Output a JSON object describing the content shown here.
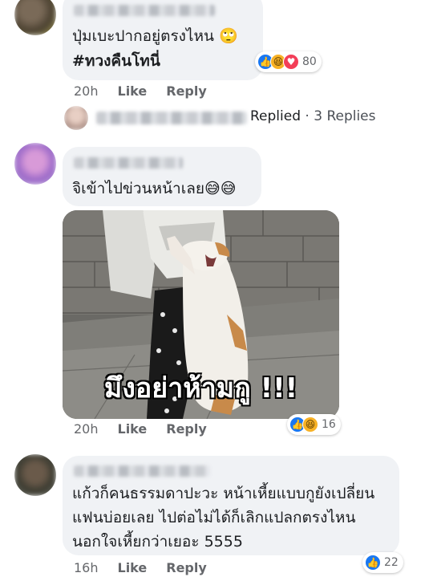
{
  "comments": [
    {
      "text_lines": [
        "ปุ่มเบะปากอยู่ตรงไหน 🙄"
      ],
      "hashtag": "#ทวงคืนโทนี่",
      "time": "20h",
      "like_label": "Like",
      "reply_label": "Reply",
      "reaction_count": "80",
      "reaction_icons": [
        "like-icon",
        "haha-icon",
        "love-icon"
      ]
    },
    {
      "text_lines": [
        "จิเข้าไปข่วนหน้าเลย😅😅"
      ],
      "image_caption": "มึงอย่าห้ามกู !!!",
      "time": "20h",
      "like_label": "Like",
      "reply_label": "Reply",
      "reaction_count": "16",
      "reaction_icons": [
        "like-icon",
        "haha-icon"
      ]
    },
    {
      "text_lines": [
        "แก้วก็คนธรรมดาปะวะ หน้าเหี้ยแบบกูยังเปลี่ยน",
        "แฟนบ่อยเลย ไปต่อไม่ได้ก็เลิกแปลกตรงไหน",
        "นอกใจเหี้ยกว่าเยอะ 5555"
      ],
      "time": "16h",
      "like_label": "Like",
      "reply_label": "Reply",
      "reaction_count": "22",
      "reaction_icons": [
        "like-icon"
      ]
    }
  ],
  "replies_summary": {
    "replied": "Replied",
    "separator": " · ",
    "count": "3 Replies"
  },
  "colors": {
    "bubble": "#f0f2f5",
    "like_blue": "#1877f2",
    "haha_yellow": "#f7b125",
    "love_red": "#f33e58",
    "meta_gray": "#65676b"
  }
}
